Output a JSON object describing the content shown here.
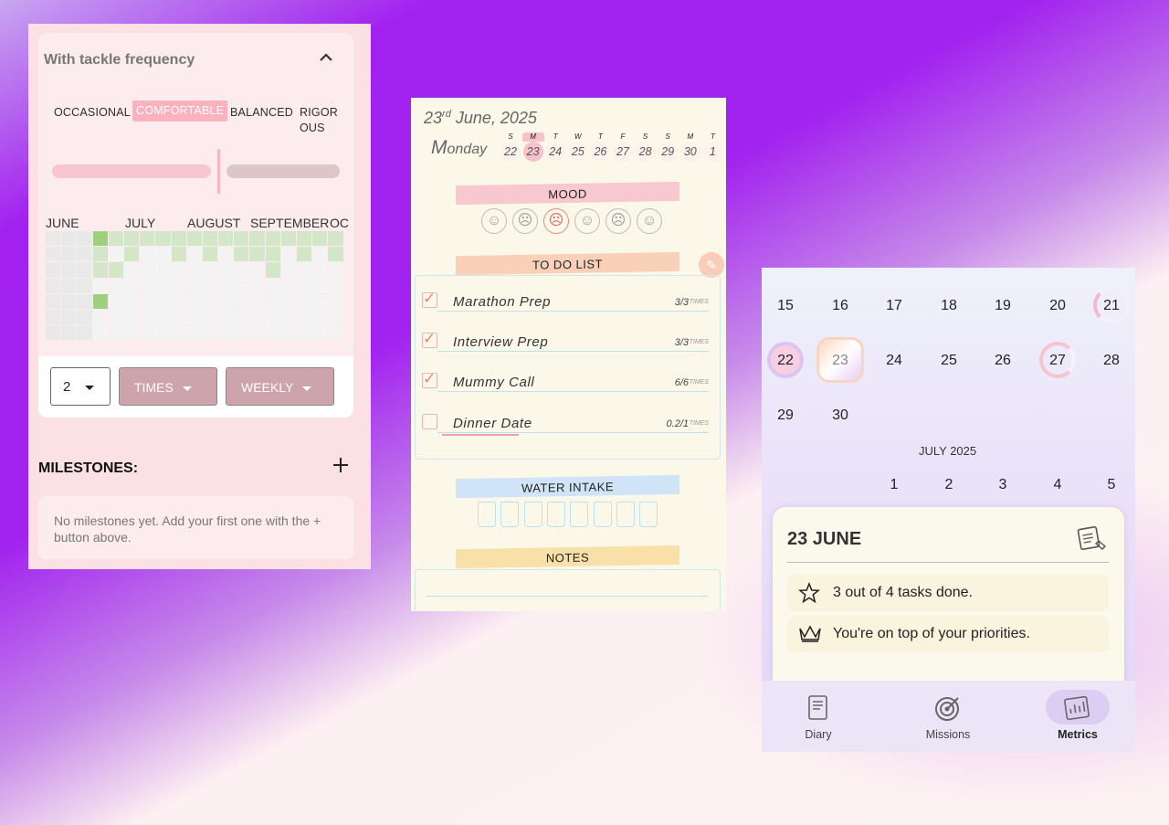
{
  "freq_panel": {
    "title": "With tackle frequency",
    "options": [
      "OCCASIONAL",
      "COMFORTABLE",
      "BALANCED",
      "RIGOR\nOUS"
    ],
    "selected_option": "COMFORTABLE",
    "months": [
      "JUNE",
      "JULY",
      "AUGUST",
      "SEPTEMBER",
      "OC"
    ],
    "count_value": "2",
    "unit_label": "TIMES",
    "period_label": "WEEKLY",
    "milestones_title": "MILESTONES:",
    "milestones_empty": "No milestones yet. Add your first one with the + button above."
  },
  "diary": {
    "day_num": "23",
    "day_suffix": "rd",
    "month_year": "June, 2025",
    "weekday_first": "M",
    "weekday_rest": "onday",
    "week_days": [
      {
        "l": "S",
        "n": "22"
      },
      {
        "l": "M",
        "n": "23"
      },
      {
        "l": "T",
        "n": "24"
      },
      {
        "l": "W",
        "n": "25"
      },
      {
        "l": "T",
        "n": "26"
      },
      {
        "l": "F",
        "n": "27"
      },
      {
        "l": "S",
        "n": "28"
      },
      {
        "l": "S",
        "n": "29"
      },
      {
        "l": "M",
        "n": "30"
      },
      {
        "l": "T",
        "n": "1"
      }
    ],
    "mood_label": "MOOD",
    "todo_label": "TO DO LIST",
    "tasks": [
      {
        "name": "Marathon Prep",
        "count": "3/3",
        "unit": "TIMES",
        "done": true
      },
      {
        "name": "Interview Prep",
        "count": "3/3",
        "unit": "TIMES",
        "done": true
      },
      {
        "name": "Mummy Call",
        "count": "6/6",
        "unit": "TIMES",
        "done": true
      },
      {
        "name": "Dinner Date",
        "count": "0.2/1",
        "unit": "TIMES",
        "done": false
      }
    ],
    "water_label": "WATER INTAKE",
    "notes_label": "NOTES"
  },
  "metrics": {
    "row1": [
      "15",
      "16",
      "17",
      "18",
      "19",
      "20",
      "21"
    ],
    "row2": [
      "22",
      "23",
      "24",
      "25",
      "26",
      "27",
      "28"
    ],
    "row3": [
      "29",
      "30"
    ],
    "month2": "JULY 2025",
    "row4": [
      "1",
      "2",
      "3",
      "4",
      "5"
    ],
    "summary_title": "23 JUNE",
    "summary_lines": [
      "3 out of 4 tasks done.",
      "You're on top of your priorities."
    ],
    "nav": [
      {
        "label": "Diary",
        "icon": "diary-icon"
      },
      {
        "label": "Missions",
        "icon": "target-icon"
      },
      {
        "label": "Metrics",
        "icon": "metrics-icon"
      }
    ],
    "active_nav": "Metrics"
  }
}
